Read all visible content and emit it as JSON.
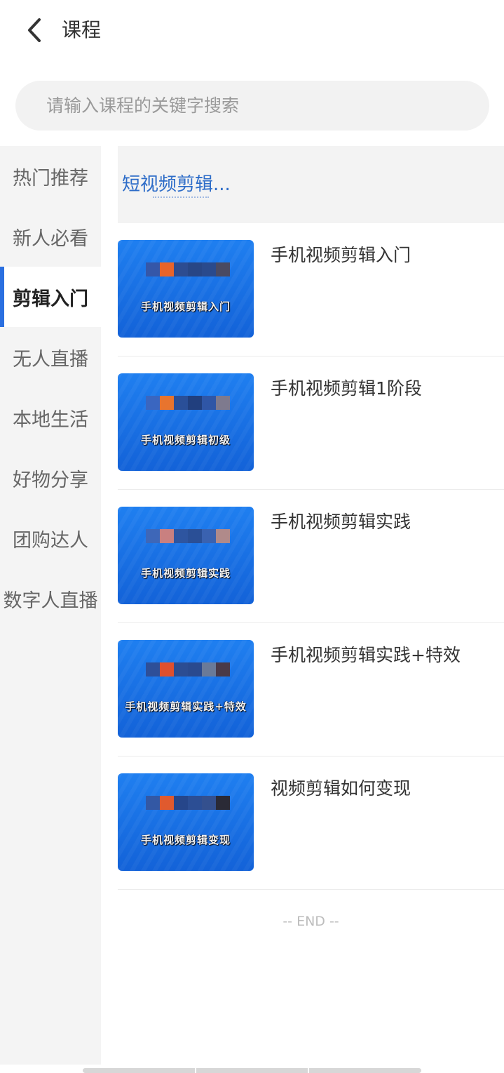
{
  "header": {
    "title": "课程",
    "back_icon": "chevron-left-icon"
  },
  "search": {
    "placeholder": "请输入课程的关键字搜索"
  },
  "sidebar": {
    "items": [
      {
        "label": "热门推荐",
        "active": false
      },
      {
        "label": "新人必看",
        "active": false
      },
      {
        "label": "剪辑入门",
        "active": true
      },
      {
        "label": "无人直播",
        "active": false
      },
      {
        "label": "本地生活",
        "active": false
      },
      {
        "label": "好物分享",
        "active": false
      },
      {
        "label": "团购达人",
        "active": false
      },
      {
        "label": "数字人直播",
        "active": false
      }
    ]
  },
  "banner": {
    "text": "短视频剪辑..."
  },
  "courses": [
    {
      "title": "手机视频剪辑入门",
      "thumb_caption": "手机视频剪辑入门"
    },
    {
      "title": "手机视频剪辑1阶段",
      "thumb_caption": "手机视频剪辑初级"
    },
    {
      "title": "手机视频剪辑实践",
      "thumb_caption": "手机视频剪辑实践"
    },
    {
      "title": "手机视频剪辑实践+特效",
      "thumb_caption": "手机视频剪辑实践+特效"
    },
    {
      "title": "视频剪辑如何变现",
      "thumb_caption": "手机视频剪辑变现"
    }
  ],
  "footer": {
    "end_text": "-- END --"
  },
  "colors": {
    "accent": "#2a6fe0",
    "banner_text": "#2d6cc8",
    "thumb_blue": "#1f7ff0"
  }
}
